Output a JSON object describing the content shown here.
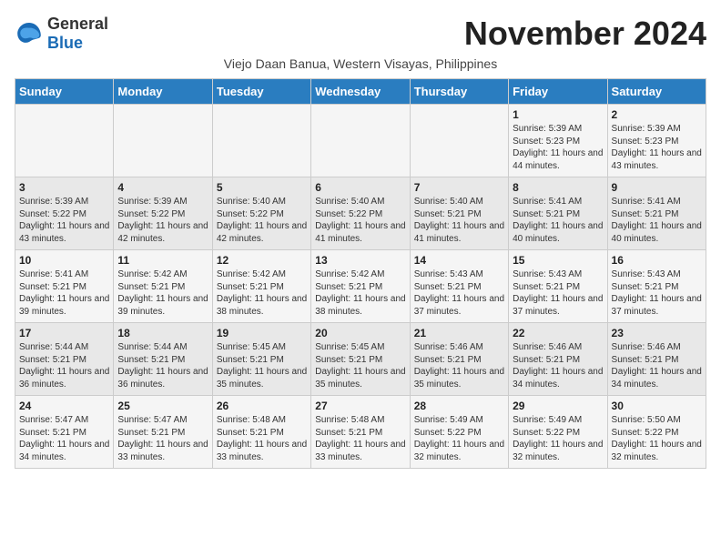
{
  "logo": {
    "general": "General",
    "blue": "Blue"
  },
  "title": "November 2024",
  "subtitle": "Viejo Daan Banua, Western Visayas, Philippines",
  "days_of_week": [
    "Sunday",
    "Monday",
    "Tuesday",
    "Wednesday",
    "Thursday",
    "Friday",
    "Saturday"
  ],
  "weeks": [
    [
      {
        "day": "",
        "sunrise": "",
        "sunset": "",
        "daylight": ""
      },
      {
        "day": "",
        "sunrise": "",
        "sunset": "",
        "daylight": ""
      },
      {
        "day": "",
        "sunrise": "",
        "sunset": "",
        "daylight": ""
      },
      {
        "day": "",
        "sunrise": "",
        "sunset": "",
        "daylight": ""
      },
      {
        "day": "",
        "sunrise": "",
        "sunset": "",
        "daylight": ""
      },
      {
        "day": "1",
        "sunrise": "Sunrise: 5:39 AM",
        "sunset": "Sunset: 5:23 PM",
        "daylight": "Daylight: 11 hours and 44 minutes."
      },
      {
        "day": "2",
        "sunrise": "Sunrise: 5:39 AM",
        "sunset": "Sunset: 5:23 PM",
        "daylight": "Daylight: 11 hours and 43 minutes."
      }
    ],
    [
      {
        "day": "3",
        "sunrise": "Sunrise: 5:39 AM",
        "sunset": "Sunset: 5:22 PM",
        "daylight": "Daylight: 11 hours and 43 minutes."
      },
      {
        "day": "4",
        "sunrise": "Sunrise: 5:39 AM",
        "sunset": "Sunset: 5:22 PM",
        "daylight": "Daylight: 11 hours and 42 minutes."
      },
      {
        "day": "5",
        "sunrise": "Sunrise: 5:40 AM",
        "sunset": "Sunset: 5:22 PM",
        "daylight": "Daylight: 11 hours and 42 minutes."
      },
      {
        "day": "6",
        "sunrise": "Sunrise: 5:40 AM",
        "sunset": "Sunset: 5:22 PM",
        "daylight": "Daylight: 11 hours and 41 minutes."
      },
      {
        "day": "7",
        "sunrise": "Sunrise: 5:40 AM",
        "sunset": "Sunset: 5:21 PM",
        "daylight": "Daylight: 11 hours and 41 minutes."
      },
      {
        "day": "8",
        "sunrise": "Sunrise: 5:41 AM",
        "sunset": "Sunset: 5:21 PM",
        "daylight": "Daylight: 11 hours and 40 minutes."
      },
      {
        "day": "9",
        "sunrise": "Sunrise: 5:41 AM",
        "sunset": "Sunset: 5:21 PM",
        "daylight": "Daylight: 11 hours and 40 minutes."
      }
    ],
    [
      {
        "day": "10",
        "sunrise": "Sunrise: 5:41 AM",
        "sunset": "Sunset: 5:21 PM",
        "daylight": "Daylight: 11 hours and 39 minutes."
      },
      {
        "day": "11",
        "sunrise": "Sunrise: 5:42 AM",
        "sunset": "Sunset: 5:21 PM",
        "daylight": "Daylight: 11 hours and 39 minutes."
      },
      {
        "day": "12",
        "sunrise": "Sunrise: 5:42 AM",
        "sunset": "Sunset: 5:21 PM",
        "daylight": "Daylight: 11 hours and 38 minutes."
      },
      {
        "day": "13",
        "sunrise": "Sunrise: 5:42 AM",
        "sunset": "Sunset: 5:21 PM",
        "daylight": "Daylight: 11 hours and 38 minutes."
      },
      {
        "day": "14",
        "sunrise": "Sunrise: 5:43 AM",
        "sunset": "Sunset: 5:21 PM",
        "daylight": "Daylight: 11 hours and 37 minutes."
      },
      {
        "day": "15",
        "sunrise": "Sunrise: 5:43 AM",
        "sunset": "Sunset: 5:21 PM",
        "daylight": "Daylight: 11 hours and 37 minutes."
      },
      {
        "day": "16",
        "sunrise": "Sunrise: 5:43 AM",
        "sunset": "Sunset: 5:21 PM",
        "daylight": "Daylight: 11 hours and 37 minutes."
      }
    ],
    [
      {
        "day": "17",
        "sunrise": "Sunrise: 5:44 AM",
        "sunset": "Sunset: 5:21 PM",
        "daylight": "Daylight: 11 hours and 36 minutes."
      },
      {
        "day": "18",
        "sunrise": "Sunrise: 5:44 AM",
        "sunset": "Sunset: 5:21 PM",
        "daylight": "Daylight: 11 hours and 36 minutes."
      },
      {
        "day": "19",
        "sunrise": "Sunrise: 5:45 AM",
        "sunset": "Sunset: 5:21 PM",
        "daylight": "Daylight: 11 hours and 35 minutes."
      },
      {
        "day": "20",
        "sunrise": "Sunrise: 5:45 AM",
        "sunset": "Sunset: 5:21 PM",
        "daylight": "Daylight: 11 hours and 35 minutes."
      },
      {
        "day": "21",
        "sunrise": "Sunrise: 5:46 AM",
        "sunset": "Sunset: 5:21 PM",
        "daylight": "Daylight: 11 hours and 35 minutes."
      },
      {
        "day": "22",
        "sunrise": "Sunrise: 5:46 AM",
        "sunset": "Sunset: 5:21 PM",
        "daylight": "Daylight: 11 hours and 34 minutes."
      },
      {
        "day": "23",
        "sunrise": "Sunrise: 5:46 AM",
        "sunset": "Sunset: 5:21 PM",
        "daylight": "Daylight: 11 hours and 34 minutes."
      }
    ],
    [
      {
        "day": "24",
        "sunrise": "Sunrise: 5:47 AM",
        "sunset": "Sunset: 5:21 PM",
        "daylight": "Daylight: 11 hours and 34 minutes."
      },
      {
        "day": "25",
        "sunrise": "Sunrise: 5:47 AM",
        "sunset": "Sunset: 5:21 PM",
        "daylight": "Daylight: 11 hours and 33 minutes."
      },
      {
        "day": "26",
        "sunrise": "Sunrise: 5:48 AM",
        "sunset": "Sunset: 5:21 PM",
        "daylight": "Daylight: 11 hours and 33 minutes."
      },
      {
        "day": "27",
        "sunrise": "Sunrise: 5:48 AM",
        "sunset": "Sunset: 5:21 PM",
        "daylight": "Daylight: 11 hours and 33 minutes."
      },
      {
        "day": "28",
        "sunrise": "Sunrise: 5:49 AM",
        "sunset": "Sunset: 5:22 PM",
        "daylight": "Daylight: 11 hours and 32 minutes."
      },
      {
        "day": "29",
        "sunrise": "Sunrise: 5:49 AM",
        "sunset": "Sunset: 5:22 PM",
        "daylight": "Daylight: 11 hours and 32 minutes."
      },
      {
        "day": "30",
        "sunrise": "Sunrise: 5:50 AM",
        "sunset": "Sunset: 5:22 PM",
        "daylight": "Daylight: 11 hours and 32 minutes."
      }
    ]
  ]
}
